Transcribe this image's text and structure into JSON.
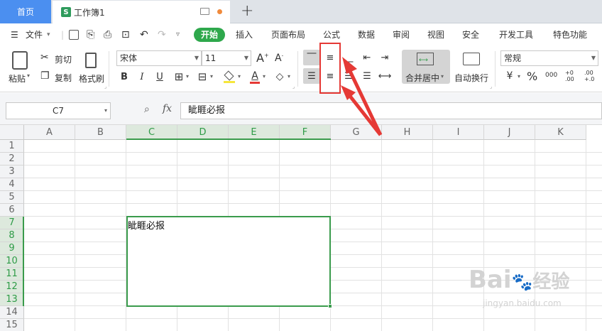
{
  "tabs": {
    "home": "首页",
    "doc_badge": "S",
    "doc_title": "工作簿1",
    "new_tab": "+"
  },
  "menu": {
    "file": "文件",
    "items": [
      "开始",
      "插入",
      "页面布局",
      "公式",
      "数据",
      "审阅",
      "视图",
      "安全",
      "开发工具",
      "特色功能"
    ]
  },
  "ribbon": {
    "paste": "粘贴",
    "cut": "剪切",
    "copy": "复制",
    "format_painter": "格式刷",
    "font_name": "宋体",
    "font_size": "11",
    "bold": "B",
    "italic": "I",
    "underline": "U",
    "font_color_letter": "A",
    "merge_center": "合并居中",
    "wrap_text": "自动换行",
    "number_format": "常规",
    "percent": "%",
    "thousands": "000",
    "inc_decimal": "+0 .00",
    "dec_decimal": ".00 +.0"
  },
  "formula_bar": {
    "name_box": "C7",
    "fx": "fx",
    "content": "眦睚必报"
  },
  "grid": {
    "columns": [
      "A",
      "B",
      "C",
      "D",
      "E",
      "F",
      "G",
      "H",
      "I",
      "J",
      "K"
    ],
    "rows": [
      "1",
      "2",
      "3",
      "4",
      "5",
      "6",
      "7",
      "8",
      "9",
      "10",
      "11",
      "12",
      "13",
      "14",
      "15"
    ],
    "selected_cell_text": "眦睚必报"
  },
  "watermark": {
    "brand": "Bai",
    "brand_cn": "经验",
    "url": "jingyan.baidu.com"
  },
  "colors": {
    "accent_green": "#2ea84c",
    "home_tab_blue": "#4b8ff0",
    "annotation_red": "#e53935"
  }
}
